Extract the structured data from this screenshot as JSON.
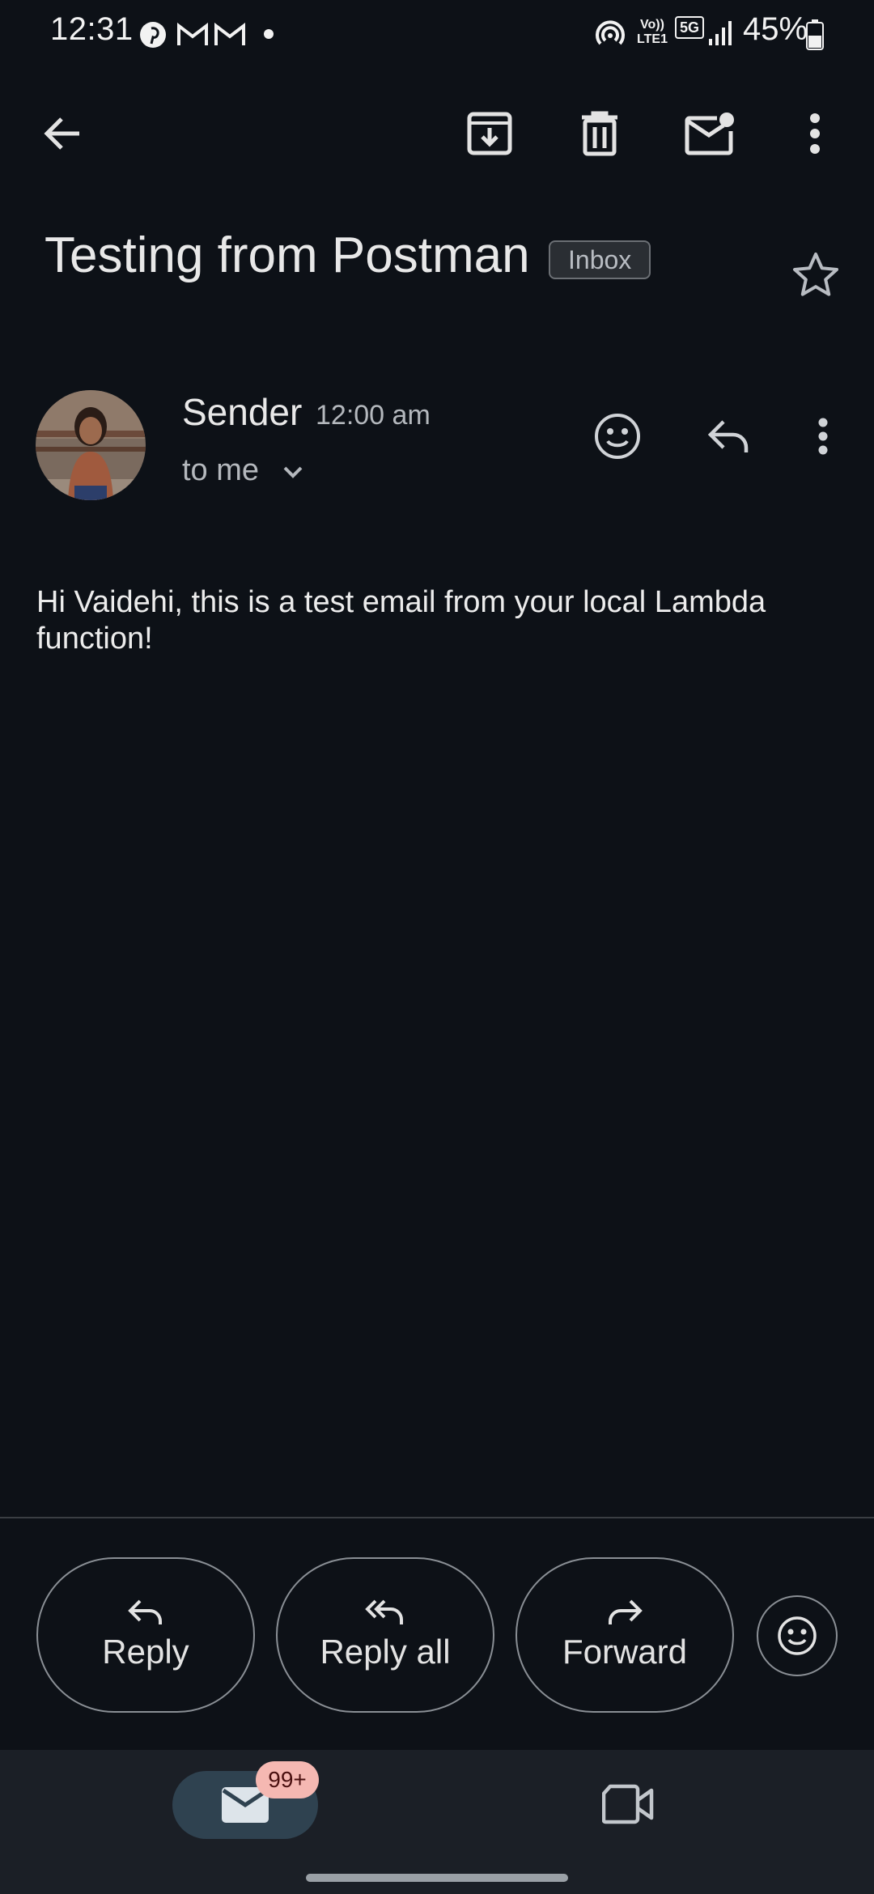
{
  "status_bar": {
    "time": "12:31",
    "battery": "45%",
    "network_small": "Vo)) LTE1",
    "network_5g": "5G"
  },
  "toolbar": {
    "back_icon": "arrow-left-icon",
    "archive_icon": "archive-icon",
    "delete_icon": "trash-icon",
    "mark_unread_icon": "mail-unread-icon",
    "more_icon": "more-vert-icon"
  },
  "email": {
    "subject": "Testing from Postman",
    "label": "Inbox",
    "sender_name": "Sender",
    "time": "12:00 am",
    "recipient": "to me",
    "body": "Hi Vaidehi, this is a test email from your local Lambda function!"
  },
  "actions": {
    "reply": "Reply",
    "reply_all": "Reply all",
    "forward": "Forward"
  },
  "bottom_nav": {
    "mail_badge": "99+"
  },
  "colors": {
    "background": "#0d1117",
    "nav_background": "#1b1f26",
    "badge": "#f5b8b2",
    "active_pill": "#2f4250"
  }
}
